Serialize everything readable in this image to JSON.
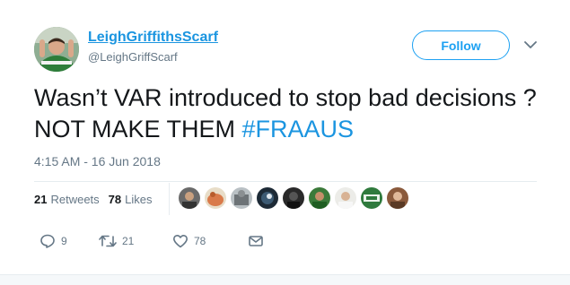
{
  "user": {
    "display_name": "LeighGriffithsScarf",
    "handle": "@LeighGriffScarf"
  },
  "follow_button": {
    "label": "Follow"
  },
  "tweet": {
    "text_part1": "Wasn’t VAR introduced to stop bad decisions ? NOT MAKE THEM ",
    "hashtag": "#FRAAUS",
    "timestamp": "4:15 AM - 16 Jun 2018"
  },
  "stats": {
    "retweets_count": "21",
    "retweets_label": "Retweets",
    "likes_count": "78",
    "likes_label": "Likes"
  },
  "liker_avatars_count": 10,
  "actions": {
    "reply_count": "9",
    "retweet_count": "21",
    "like_count": "78"
  },
  "colors": {
    "link_blue": "#1b95e0",
    "follow_blue": "#1da1f2",
    "muted": "#657786",
    "text": "#14171a"
  },
  "icons": [
    "caret-down-icon",
    "reply-icon",
    "retweet-icon",
    "heart-icon",
    "mail-icon"
  ]
}
